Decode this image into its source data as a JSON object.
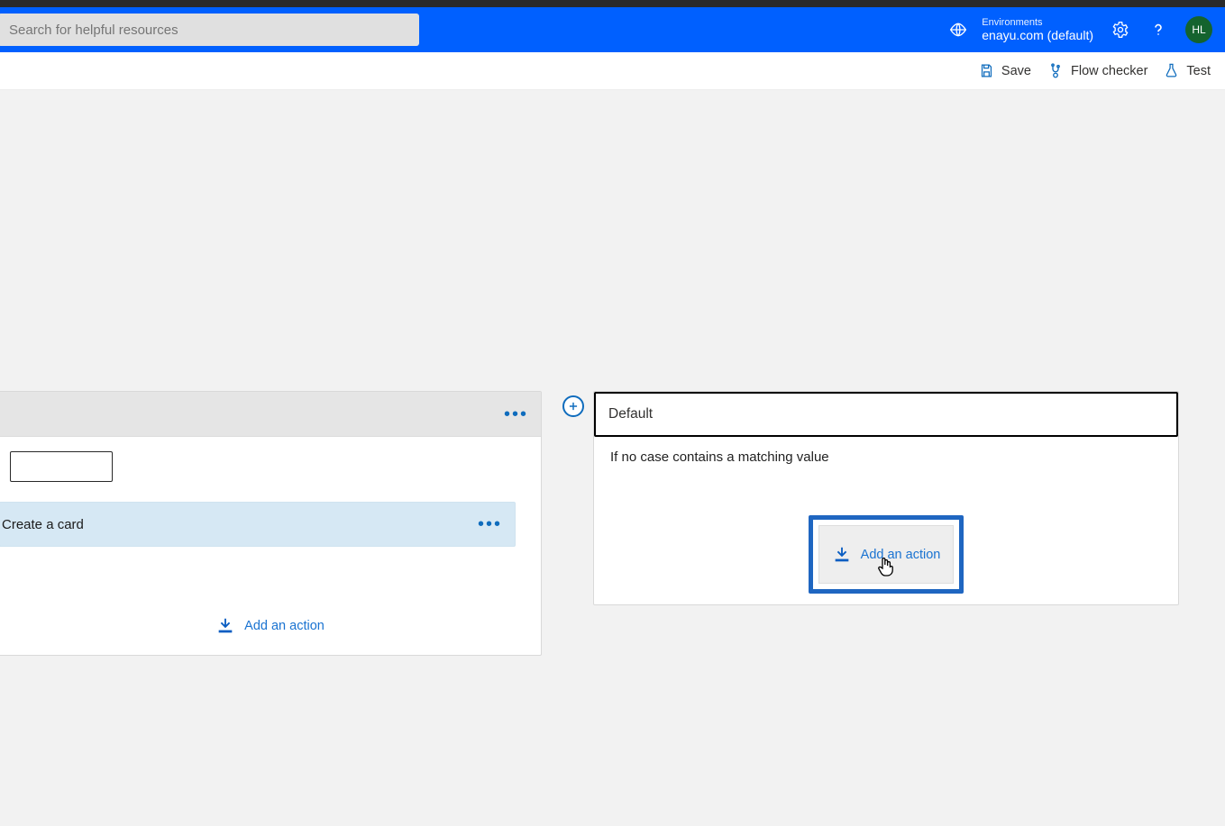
{
  "search": {
    "placeholder": "Search for helpful resources"
  },
  "environments": {
    "label": "Environments",
    "name": "enayu.com (default)"
  },
  "avatar": {
    "initials": "HL"
  },
  "commands": {
    "save": "Save",
    "flowChecker": "Flow checker",
    "test": "Test"
  },
  "caseCard": {
    "action": "Create a card",
    "addAction": "Add an action"
  },
  "defaultCard": {
    "title": "Default",
    "subtitle": "If no case contains a matching value",
    "addAction": "Add an action"
  }
}
